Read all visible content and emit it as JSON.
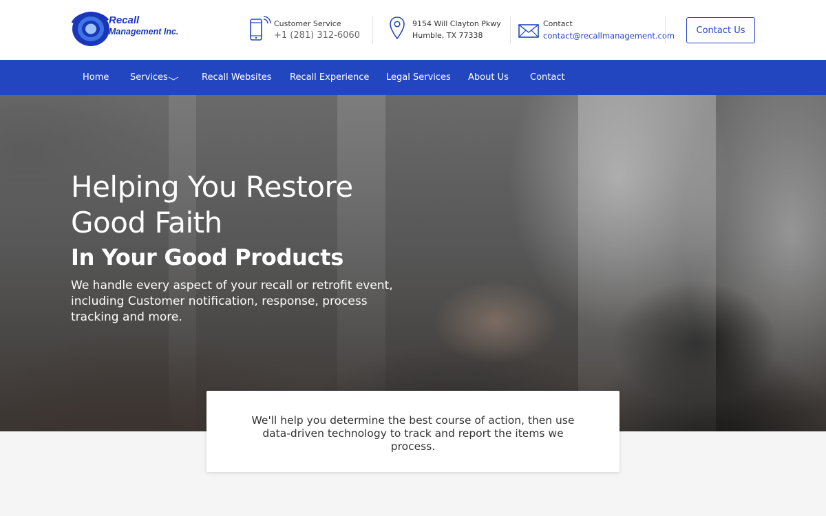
{
  "brand": {
    "name_line1": "Recall",
    "name_line2": "Management Inc.",
    "color": "#1a37b8"
  },
  "header": {
    "phone": {
      "icon": "phone-icon",
      "label": "Customer Service",
      "value": "+1 (281) 312-6060"
    },
    "address": {
      "icon": "map-pin-icon",
      "line1": "9154 Will Clayton Pkwy",
      "line2": "Humble, TX 77338"
    },
    "email": {
      "icon": "envelope-icon",
      "label": "Contact",
      "value": "contact@recallmanagement.com"
    },
    "cta_label": "Contact Us"
  },
  "nav": {
    "color": "#2246c0",
    "items": [
      {
        "label": "Home"
      },
      {
        "label": "Services",
        "icon": "chevron-down-icon"
      },
      {
        "label": "Recall Websites"
      },
      {
        "label": "Recall Experience"
      },
      {
        "label": "Legal Services"
      },
      {
        "label": "About Us"
      },
      {
        "label": "Contact"
      }
    ]
  },
  "hero": {
    "title": "Helping You Restore Good Faith",
    "subtitle": "In Your Good Products",
    "text": "We handle every aspect of your recall or retrofit event, including Customer notification, response, process tracking and more."
  },
  "card": {
    "text": "We'll help you determine the best course of action, then use data-driven technology to track and report the items we process."
  }
}
